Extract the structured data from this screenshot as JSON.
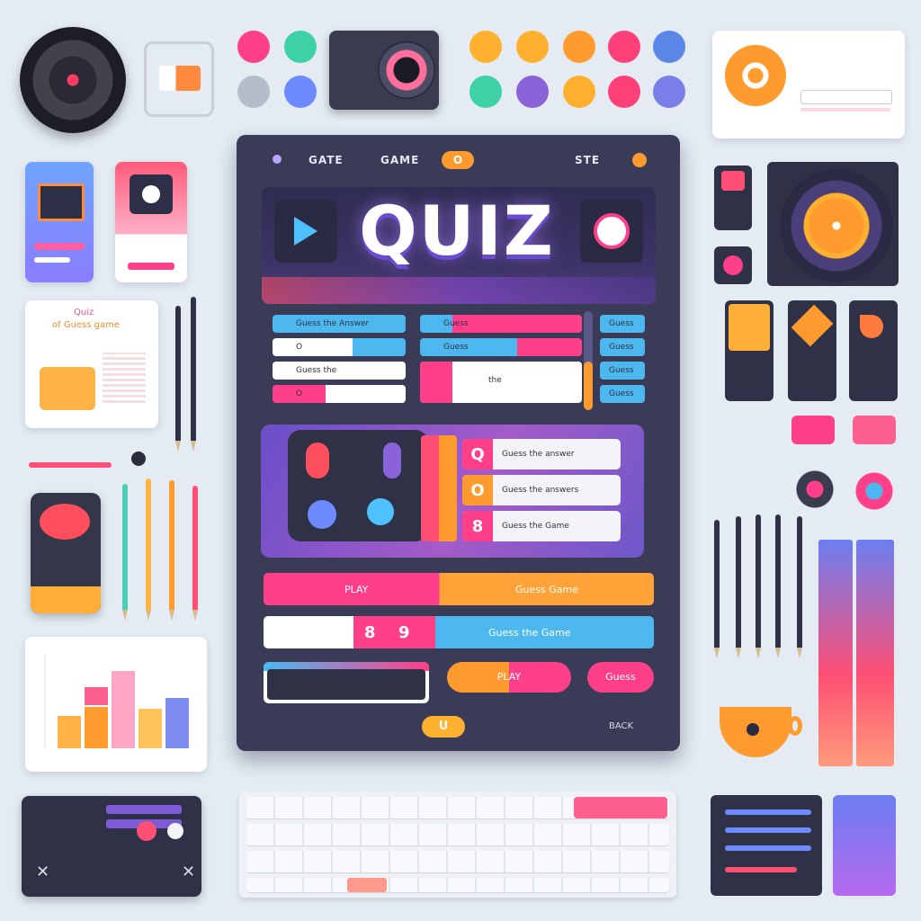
{
  "tablet": {
    "tabs": [
      "GATE",
      "GAME",
      "STE"
    ],
    "tab_badge": "O",
    "title": "QUIZ",
    "questions_left": [
      "Guess the Answer",
      "O",
      "Guess the",
      "O"
    ],
    "questions_right": [
      "Guess",
      "Guess",
      "the",
      "Guess"
    ],
    "side_buttons": [
      "Guess",
      "Guess",
      "Guess",
      "Guess"
    ],
    "answers": [
      {
        "tag": "Q",
        "text": "Guess the answer",
        "color": "#ff3f8a"
      },
      {
        "tag": "O",
        "text": "Guess the answers",
        "color": "#ff9a2e"
      },
      {
        "tag": "8",
        "text": "Guess the Game",
        "color": "#ff3f8a"
      }
    ],
    "bar1_left": "PLAY",
    "bar1_right": "Guess Game",
    "bar2_tags": [
      "8",
      "9"
    ],
    "bar2_right": "Guess the Game",
    "action_play": "PLAY",
    "action_guess": "Guess",
    "footer_badge": "U",
    "footer_right": "BACK"
  },
  "cards": {
    "notebook_title": "Quiz",
    "notebook_sub": "of Guess game"
  },
  "colors": {
    "pink": "#ff3f8a",
    "orange": "#ff9a2e",
    "blue": "#4db8f0",
    "purple": "#7e5bd6",
    "dark": "#2f3147"
  },
  "icons": [
    "speaker-icon",
    "camera-icon",
    "play-icon",
    "timer-icon",
    "coffee-cup-icon",
    "keyboard-icon"
  ]
}
